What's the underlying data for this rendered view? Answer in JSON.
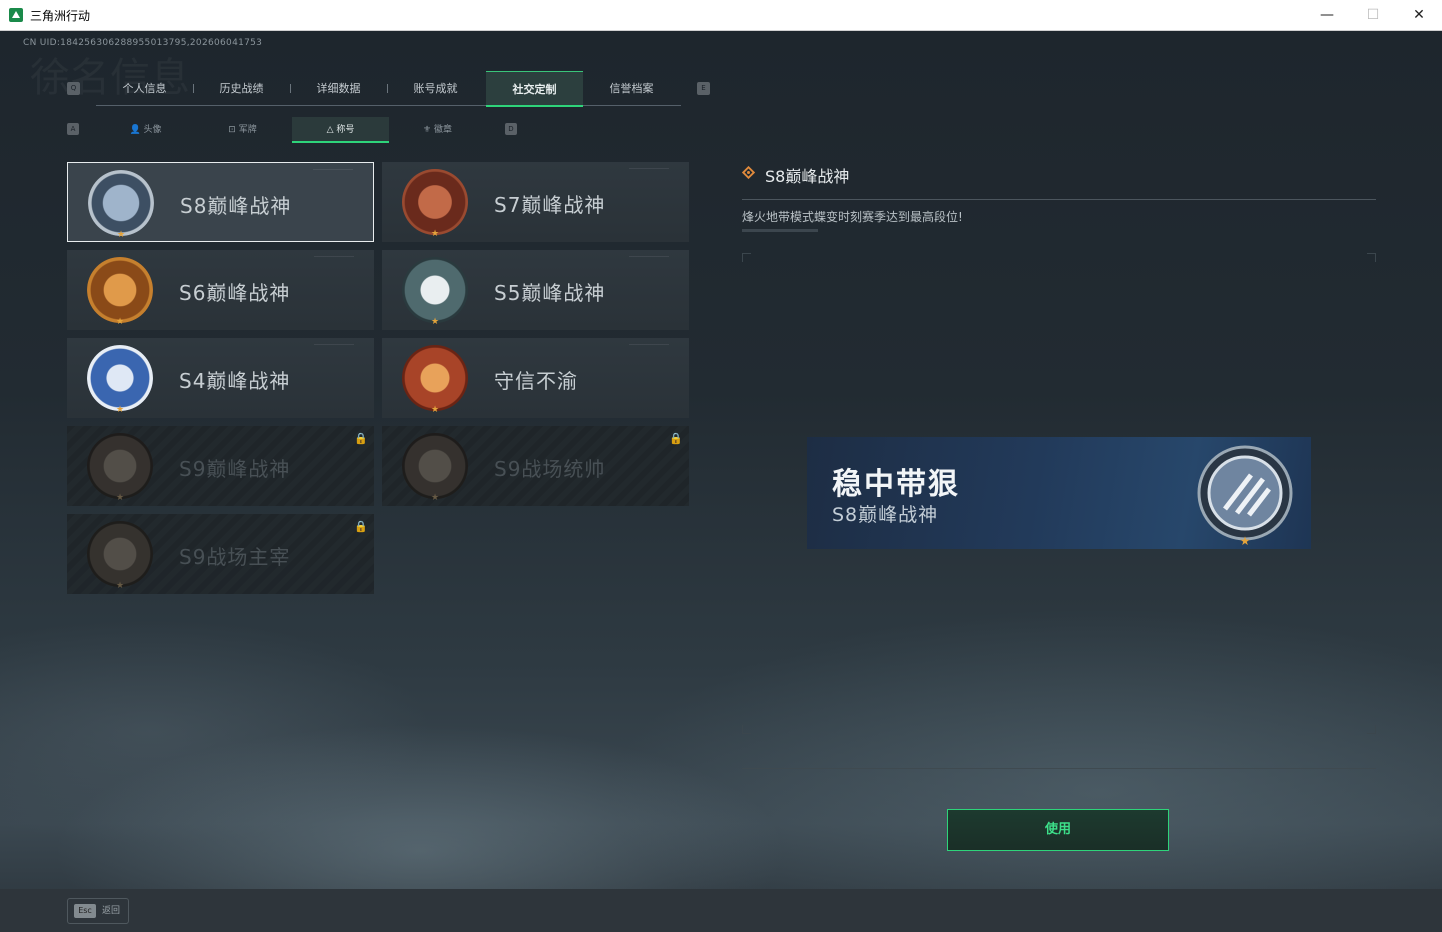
{
  "window": {
    "title": "三角洲行动",
    "minimize": "—",
    "maximize": "☐",
    "close": "✕"
  },
  "uid": "CN UID:1842563062889550137​95,202606041753",
  "watermark": "徐名信息",
  "main_tabs": {
    "key_left": "Q",
    "key_right": "E",
    "items": [
      {
        "label": "个人信息"
      },
      {
        "label": "历史战绩"
      },
      {
        "label": "详细数据"
      },
      {
        "label": "账号成就"
      },
      {
        "label": "社交定制",
        "active": true
      },
      {
        "label": "信誉档案"
      }
    ]
  },
  "sub_tabs": {
    "key_left": "A",
    "key_right": "D",
    "items": [
      {
        "label": "头像",
        "icon": "person-icon"
      },
      {
        "label": "军牌",
        "icon": "dogtag-icon"
      },
      {
        "label": "称号",
        "icon": "triangle-icon",
        "active": true
      },
      {
        "label": "徽章",
        "icon": "emblem-icon"
      }
    ]
  },
  "titles": [
    {
      "name": "S8巅峰战神",
      "selected": true,
      "locked": false,
      "badge": "diagonal-stripes-badge",
      "color": "#7e94ad"
    },
    {
      "name": "S7巅峰战神",
      "selected": false,
      "locked": false,
      "badge": "rifle-badge",
      "color": "#9a4a30"
    },
    {
      "name": "S6巅峰战神",
      "selected": false,
      "locked": false,
      "badge": "t-shield-badge",
      "color": "#b66a24"
    },
    {
      "name": "S5巅峰战神",
      "selected": false,
      "locked": false,
      "badge": "skull-badge",
      "color": "#4f6a6e"
    },
    {
      "name": "S4巅峰战神",
      "selected": false,
      "locked": false,
      "badge": "helmet-badge",
      "color": "#3a66b0"
    },
    {
      "name": "守信不渝",
      "selected": false,
      "locked": false,
      "badge": "scales-badge",
      "color": "#a84428"
    },
    {
      "name": "S9巅峰战神",
      "selected": false,
      "locked": true,
      "badge": "fortress-badge",
      "color": "#6a5a48"
    },
    {
      "name": "S9战场统帅",
      "selected": false,
      "locked": true,
      "badge": "warship-badge",
      "color": "#6a5a48"
    },
    {
      "name": "S9战场主宰",
      "selected": false,
      "locked": true,
      "badge": "mushroom-cloud-badge",
      "color": "#6a5a48"
    }
  ],
  "detail": {
    "title": "S8巅峰战神",
    "description": "烽火地带模式蝶变时刻赛季达到最高段位!",
    "preview_main": "稳中带狠",
    "preview_sub": "S8巅峰战神"
  },
  "use_button": "使用",
  "esc": {
    "key": "Esc",
    "label": "返回"
  },
  "colors": {
    "accent": "#2ed47a",
    "star": "#e3a33c"
  }
}
